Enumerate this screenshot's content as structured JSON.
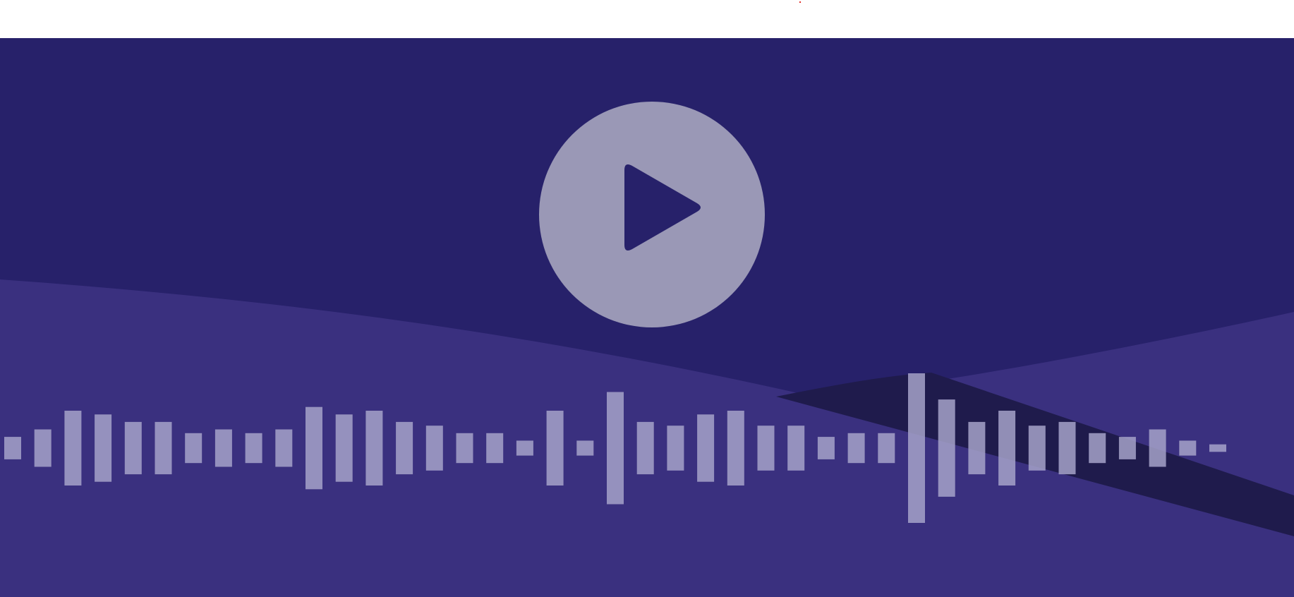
{
  "player": {
    "state": "paused",
    "waveform_levels": [
      0.15,
      0.25,
      0.5,
      0.45,
      0.35,
      0.35,
      0.2,
      0.25,
      0.2,
      0.25,
      0.55,
      0.45,
      0.5,
      0.35,
      0.3,
      0.2,
      0.2,
      0.1,
      0.5,
      0.1,
      0.75,
      0.35,
      0.3,
      0.45,
      0.5,
      0.3,
      0.3,
      0.15,
      0.2,
      0.2,
      1.0,
      0.65,
      0.35,
      0.5,
      0.3,
      0.35,
      0.2,
      0.15,
      0.25,
      0.1,
      0.05
    ]
  },
  "icons": {
    "play": "play-icon"
  },
  "colors": {
    "background_top": "#27216a",
    "background_bottom": "#3a307f",
    "accent_dark": "#1f1b4c",
    "play_circle": "#9a98b6",
    "wave_bar": "#a6a2c9",
    "marker": "#e0302a"
  }
}
